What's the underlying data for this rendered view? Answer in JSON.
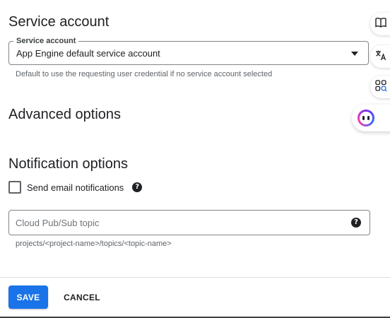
{
  "service_account": {
    "heading": "Service account",
    "field_label": "Service account",
    "selected_value": "App Engine default service account",
    "helper_text": "Default to use the requesting user credential if no service account selected"
  },
  "advanced": {
    "heading": "Advanced options"
  },
  "notifications": {
    "heading": "Notification options",
    "email_checkbox_label": "Send email notifications",
    "email_checked": false,
    "pubsub_placeholder": "Cloud Pub/Sub topic",
    "pubsub_helper": "projects/<project-name>/topics/<topic-name>"
  },
  "help_glyph": "?",
  "actions": {
    "save_label": "SAVE",
    "cancel_label": "CANCEL"
  },
  "side_tools": [
    "book-icon",
    "translate-icon",
    "apps-search-icon",
    "assistant-icon"
  ],
  "colors": {
    "primary": "#1a73e8",
    "text": "#202124",
    "muted": "#5f6368"
  }
}
